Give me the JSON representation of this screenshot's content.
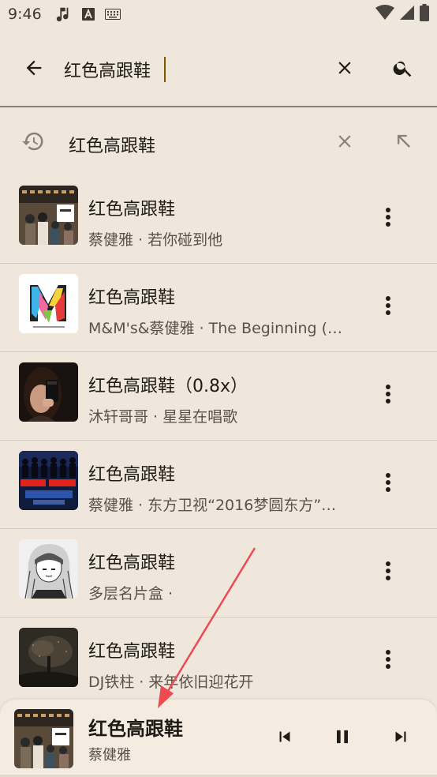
{
  "status_bar": {
    "time": "9:46"
  },
  "search": {
    "query": "红色高跟鞋",
    "placeholder": ""
  },
  "history": {
    "text": "红色高跟鞋"
  },
  "songs": [
    {
      "title": "红色高跟鞋",
      "subtitle": "蔡健雅 · 若你碰到他",
      "cover": "photo-station"
    },
    {
      "title": "红色高跟鞋",
      "subtitle": "M&M's&蔡健雅 · The Beginning (…",
      "cover": "m-logo"
    },
    {
      "title": "红色高跟鞋（0.8x）",
      "subtitle": "沐轩哥哥 · 星星在唱歌",
      "cover": "selfie"
    },
    {
      "title": "红色高跟鞋",
      "subtitle": "蔡健雅 · 东方卫视“2016梦圆东方”…",
      "cover": "stage"
    },
    {
      "title": "红色高跟鞋",
      "subtitle": "多层名片盒 ·",
      "cover": "anime-girl"
    },
    {
      "title": "红色高跟鞋",
      "subtitle": "DJ铁柱 · 来年依旧迎花开",
      "cover": "dark-tree"
    }
  ],
  "player": {
    "title": "红色高跟鞋",
    "artist": "蔡健雅",
    "progress": 0.0
  },
  "colors": {
    "background": "#efe7db",
    "accent": "#a07a2c",
    "annotation_arrow": "#ee4a52"
  }
}
